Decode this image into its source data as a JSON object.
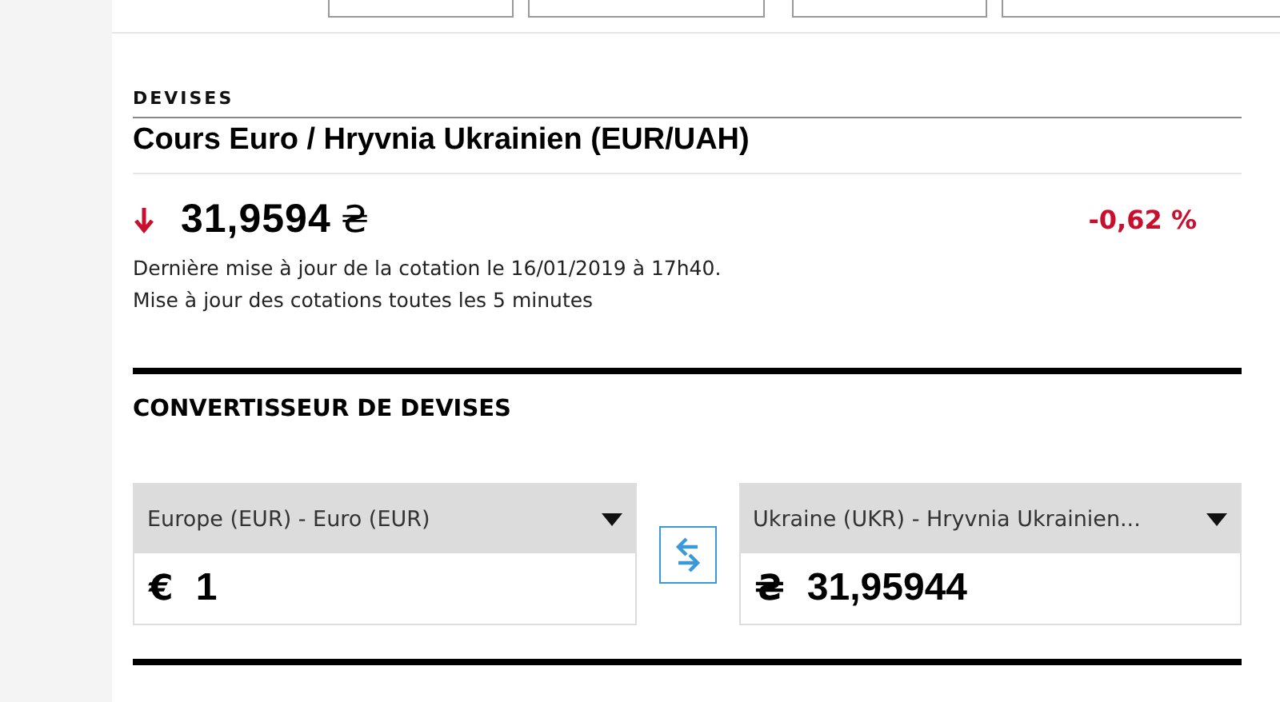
{
  "section_label": "DEVISES",
  "title": "Cours Euro / Hryvnia Ukrainien (EUR/UAH)",
  "quote": {
    "falling": true,
    "value": "31,9594",
    "currency_symbol": "₴",
    "change": "-0,62 %"
  },
  "notes": [
    "Dernière mise à jour de la cotation le 16/01/2019 à 17h40.",
    "Mise à jour des cotations toutes les 5 minutes"
  ],
  "converter": {
    "title": "CONVERTISSEUR DE DEVISES",
    "from": {
      "currency": "Europe (EUR) - Euro (EUR)",
      "symbol": "€",
      "amount": "1"
    },
    "to": {
      "currency": "Ukraine (UKR) - Hryvnia Ukrainien...",
      "symbol": "₴",
      "amount": "31,95944"
    }
  }
}
